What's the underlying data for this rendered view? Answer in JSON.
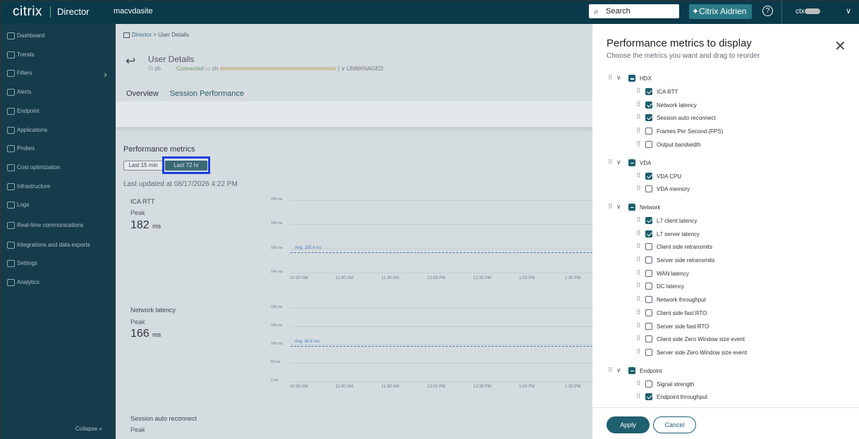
{
  "topbar": {
    "logo": "citrix",
    "product": "Director",
    "site": "macvdasite",
    "search": "Search",
    "aidrien": "Citrix Aidrien",
    "user": "ctx"
  },
  "sidebar": {
    "items": [
      "Dashboard",
      "Trends",
      "Filters",
      "Alerts",
      "Endpoint",
      "Applications",
      "Probes",
      "Cost optimization",
      "Infrastructure",
      "Logs",
      "Real-time communications",
      "Integrations and data exports",
      "Settings",
      "Analytics"
    ],
    "collapse": "Collapse"
  },
  "main": {
    "breadcrumb_root": "Director",
    "breadcrumb_current": "User Details",
    "title": "User Details",
    "user_short": "zh",
    "status": "Connected",
    "machine_short": "zh",
    "unmanaged": "UNMANAGED",
    "tabs": [
      "Overview",
      "Session Performance"
    ],
    "perf_title": "Performance metrics",
    "range_15": "Last 15 min",
    "range_72": "Last 72 hr",
    "last_updated": "Last updated at 08/17/2026 4:22 PM",
    "metric1": {
      "name": "ICA RTT",
      "peak_label": "Peak",
      "peak": "182",
      "unit": "ms",
      "avg": "Avg: 155.4 ms",
      "yticks": [
        "200 ms",
        "180 ms",
        "160 ms",
        "140 ms"
      ]
    },
    "metric2": {
      "name": "Network latency",
      "peak_label": "Peak",
      "peak": "166",
      "unit": "ms",
      "avg": "Avg: 86.8 ms",
      "yticks": [
        "200 ms",
        "150 ms",
        "100 ms",
        "50 ms",
        "0 ms"
      ]
    },
    "metric3": {
      "name": "Session auto reconnect",
      "peak_label": "Peak"
    },
    "xticks": [
      "10:30 AM",
      "11:00 AM",
      "11:30 AM",
      "12:00 PM",
      "12:30 PM",
      "1:00 PM",
      "1:30 PM"
    ]
  },
  "panel": {
    "title": "Performance metrics to display",
    "subtitle": "Choose the metrics you want and drag to reorder",
    "groups": [
      {
        "name": "HDX",
        "items": [
          {
            "label": "ICA RTT",
            "checked": true
          },
          {
            "label": "Network latency",
            "checked": true
          },
          {
            "label": "Session auto reconnect",
            "checked": true
          },
          {
            "label": "Frames Per Second (FPS)",
            "checked": false
          },
          {
            "label": "Output bandwidth",
            "checked": false
          }
        ]
      },
      {
        "name": "VDA",
        "items": [
          {
            "label": "VDA CPU",
            "checked": true
          },
          {
            "label": "VDA memory",
            "checked": false
          }
        ]
      },
      {
        "name": "Network",
        "items": [
          {
            "label": "L7 client latency",
            "checked": true
          },
          {
            "label": "L7 server latency",
            "checked": true
          },
          {
            "label": "Client side retransmits",
            "checked": false
          },
          {
            "label": "Server side retransmits",
            "checked": false
          },
          {
            "label": "WAN latency",
            "checked": false
          },
          {
            "label": "DC latency",
            "checked": false
          },
          {
            "label": "Network throughput",
            "checked": false
          },
          {
            "label": "Client side fast RTO",
            "checked": false
          },
          {
            "label": "Server side fast RTO",
            "checked": false
          },
          {
            "label": "Client side Zero Window size event",
            "checked": false
          },
          {
            "label": "Server side Zero Window size event",
            "checked": false
          }
        ]
      },
      {
        "name": "Endpoint",
        "items": [
          {
            "label": "Signal strength",
            "checked": false
          },
          {
            "label": "Endpoint throughput",
            "checked": true
          }
        ]
      }
    ],
    "apply": "Apply",
    "cancel": "Cancel"
  }
}
